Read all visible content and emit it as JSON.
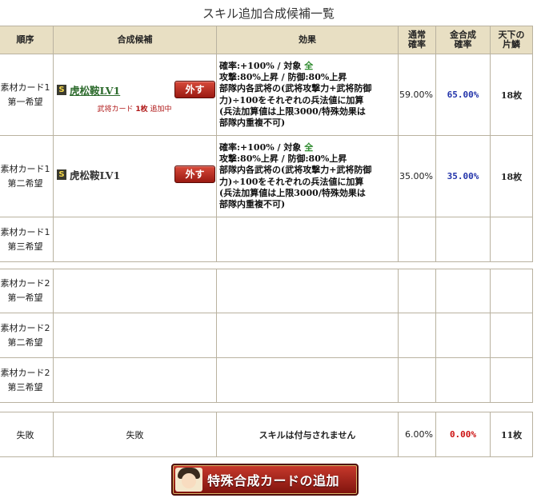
{
  "title": "スキル追加合成候補一覧",
  "header": {
    "seq": "順序",
    "candidate": "合成候補",
    "effect": "効果",
    "normal_rate": [
      "通常",
      "確率"
    ],
    "gold_rate": [
      "金合成",
      "確率"
    ],
    "tenka": [
      "天下の",
      "片鱗"
    ]
  },
  "group1": [
    {
      "seq": [
        "素材カード1",
        "第一希望"
      ],
      "skill": "虎松鞍LV1",
      "badge": "S",
      "remove_label": "外す",
      "note_prefix": "武将カード",
      "note_count": "1枚",
      "note_suffix": "追加中",
      "effect_line1": "確率:+100% / 対象",
      "effect_target": "全",
      "effect_rest": [
        "攻撃:80%上昇 / 防御:80%上昇",
        "部隊内各武将の(武将攻撃力+武将防御",
        "力)÷100をそれぞれの兵法値に加算",
        "(兵法加算値は上限3000/特殊効果は",
        "部隊内重複不可)"
      ],
      "normal_rate": "59.00%",
      "gold_rate": "65.00%",
      "tenka": "18枚"
    },
    {
      "seq": [
        "素材カード1",
        "第二希望"
      ],
      "skill": "虎松鞍LV1",
      "badge": "S",
      "remove_label": "外す",
      "effect_line1": "確率:+100% / 対象",
      "effect_target": "全",
      "effect_rest": [
        "攻撃:80%上昇 / 防御:80%上昇",
        "部隊内各武将の(武将攻撃力+武将防御",
        "力)÷100をそれぞれの兵法値に加算",
        "(兵法加算値は上限3000/特殊効果は",
        "部隊内重複不可)"
      ],
      "normal_rate": "35.00%",
      "gold_rate": "35.00%",
      "tenka": "18枚"
    },
    {
      "seq": [
        "素材カード1",
        "第三希望"
      ]
    }
  ],
  "group2": [
    {
      "seq": [
        "素材カード2",
        "第一希望"
      ]
    },
    {
      "seq": [
        "素材カード2",
        "第二希望"
      ]
    },
    {
      "seq": [
        "素材カード2",
        "第三希望"
      ]
    }
  ],
  "fail_row": {
    "seq": "失敗",
    "candidate": "失敗",
    "effect": "スキルは付与されません",
    "normal_rate": "6.00%",
    "gold_rate": "0.00%",
    "tenka": "11枚"
  },
  "add_button": {
    "label": "特殊合成カードの追加",
    "icon": "general-portrait-icon"
  },
  "colors": {
    "header_bg": "#e8dfc3",
    "gold_rate": "#2233aa",
    "gold_rate_fail": "#cc1111",
    "skill_link": "#2d6b2d",
    "remove_button": "#b8261a"
  }
}
